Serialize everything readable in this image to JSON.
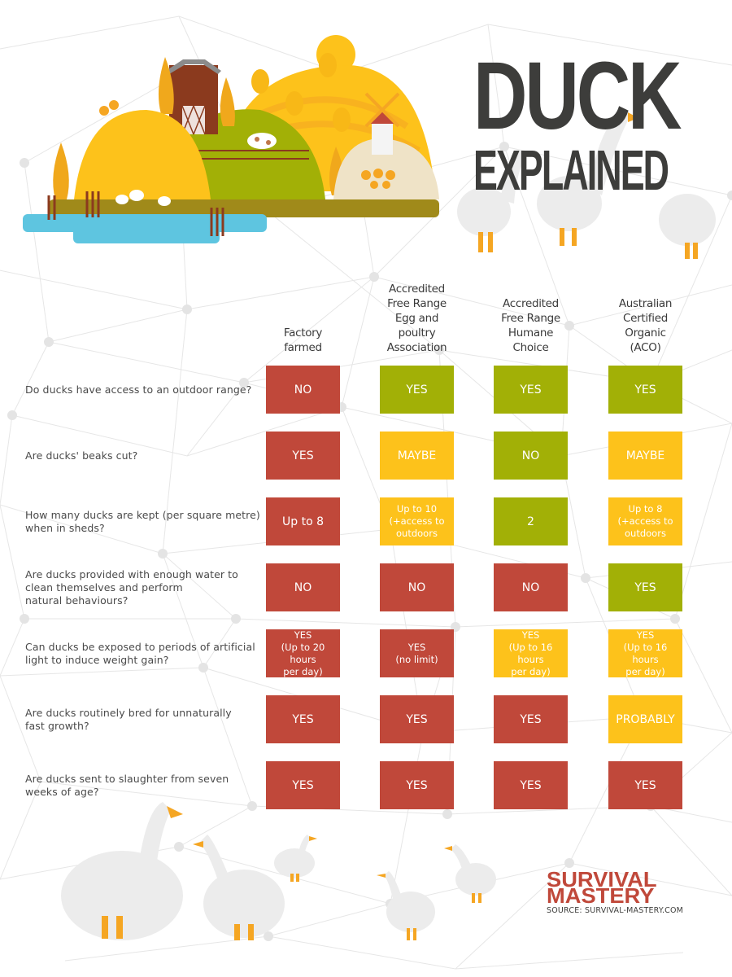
{
  "title": {
    "line1": "DUCK",
    "line2": "EXPLAINED"
  },
  "columns": [
    {
      "label": "Factory farmed",
      "lines": [
        "Factory",
        "farmed"
      ]
    },
    {
      "label": "Accredited Free Range Egg and poultry Association",
      "lines": [
        "Accredited",
        "Free Range",
        "Egg and",
        "poultry",
        "Association"
      ]
    },
    {
      "label": "Accredited Free Range Humane Choice",
      "lines": [
        "Accredited",
        "Free Range",
        "Humane",
        "Choice"
      ]
    },
    {
      "label": "Australian Certified Organic (ACO)",
      "lines": [
        "Australian",
        "Certified",
        "Organic",
        "(ACO)"
      ]
    }
  ],
  "rows": [
    {
      "question": [
        "Do ducks have access to an outdoor range?"
      ],
      "answers": [
        {
          "text": [
            "NO"
          ],
          "status": "bad"
        },
        {
          "text": [
            "YES"
          ],
          "status": "good"
        },
        {
          "text": [
            "YES"
          ],
          "status": "good"
        },
        {
          "text": [
            "YES"
          ],
          "status": "good"
        }
      ]
    },
    {
      "question": [
        "Are ducks' beaks cut?"
      ],
      "answers": [
        {
          "text": [
            "YES"
          ],
          "status": "bad"
        },
        {
          "text": [
            "MAYBE"
          ],
          "status": "uncertain"
        },
        {
          "text": [
            "NO"
          ],
          "status": "good"
        },
        {
          "text": [
            "MAYBE"
          ],
          "status": "uncertain"
        }
      ]
    },
    {
      "question": [
        "How many ducks are kept (per square metre)",
        "when in sheds?"
      ],
      "answers": [
        {
          "text": [
            "Up to 8"
          ],
          "status": "bad"
        },
        {
          "text": [
            "Up to 10",
            "(+access to",
            "outdoors"
          ],
          "status": "uncertain"
        },
        {
          "text": [
            "2"
          ],
          "status": "good"
        },
        {
          "text": [
            "Up to 8",
            "(+access to",
            "outdoors"
          ],
          "status": "uncertain"
        }
      ]
    },
    {
      "question": [
        "Are ducks provided with enough water to",
        "clean themselves and perform",
        "natural behaviours?"
      ],
      "answers": [
        {
          "text": [
            "NO"
          ],
          "status": "bad"
        },
        {
          "text": [
            "NO"
          ],
          "status": "bad"
        },
        {
          "text": [
            "NO"
          ],
          "status": "bad"
        },
        {
          "text": [
            "YES"
          ],
          "status": "good"
        }
      ]
    },
    {
      "question": [
        "Can ducks be exposed to periods of artificial",
        "light to induce weight gain?"
      ],
      "answers": [
        {
          "text": [
            "YES",
            "(Up to 20 hours",
            "per day)"
          ],
          "status": "bad"
        },
        {
          "text": [
            "YES",
            "(no limit)"
          ],
          "status": "bad"
        },
        {
          "text": [
            "YES",
            "(Up to 16 hours",
            "per day)"
          ],
          "status": "uncertain"
        },
        {
          "text": [
            "YES",
            "(Up to 16 hours",
            "per day)"
          ],
          "status": "uncertain"
        }
      ]
    },
    {
      "question": [
        "Are ducks routinely bred for unnaturally",
        "fast growth?"
      ],
      "answers": [
        {
          "text": [
            "YES"
          ],
          "status": "bad"
        },
        {
          "text": [
            "YES"
          ],
          "status": "bad"
        },
        {
          "text": [
            "YES"
          ],
          "status": "bad"
        },
        {
          "text": [
            "PROBABLY"
          ],
          "status": "uncertain"
        }
      ]
    },
    {
      "question": [
        "Are ducks sent to slaughter from seven",
        "weeks of age?"
      ],
      "answers": [
        {
          "text": [
            "YES"
          ],
          "status": "bad"
        },
        {
          "text": [
            "YES"
          ],
          "status": "bad"
        },
        {
          "text": [
            "YES"
          ],
          "status": "bad"
        },
        {
          "text": [
            "YES"
          ],
          "status": "bad"
        }
      ]
    }
  ],
  "status_colors": {
    "bad": "#c0483a",
    "good": "#a2b006",
    "uncertain": "#fdc21b"
  },
  "brand": {
    "line1": "SURVIVAL",
    "line2": "MASTERY",
    "source": "SOURCE: SURVIVAL-MASTERY.COM"
  },
  "illustrations": {
    "hero": "farm-scene-illustration",
    "geese": "white-geese-illustration"
  }
}
